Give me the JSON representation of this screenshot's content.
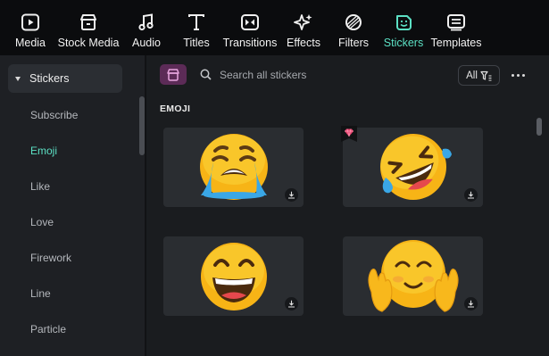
{
  "toolbar": {
    "items": [
      {
        "label": "Media",
        "icon": "media-icon"
      },
      {
        "label": "Stock Media",
        "icon": "stock-media-icon"
      },
      {
        "label": "Audio",
        "icon": "music-note-icon"
      },
      {
        "label": "Titles",
        "icon": "text-t-icon"
      },
      {
        "label": "Transitions",
        "icon": "transitions-icon"
      },
      {
        "label": "Effects",
        "icon": "effects-sparkle-icon"
      },
      {
        "label": "Filters",
        "icon": "filters-icon"
      },
      {
        "label": "Stickers",
        "icon": "stickers-icon",
        "active": true
      },
      {
        "label": "Templates",
        "icon": "templates-icon"
      }
    ]
  },
  "sidebar": {
    "header": "Stickers",
    "items": [
      {
        "label": "Subscribe"
      },
      {
        "label": "Emoji",
        "active": true
      },
      {
        "label": "Like"
      },
      {
        "label": "Love"
      },
      {
        "label": "Firework"
      },
      {
        "label": "Line"
      },
      {
        "label": "Particle"
      }
    ]
  },
  "search": {
    "placeholder": "Search all stickers"
  },
  "filter": {
    "label": "All"
  },
  "section": {
    "title": "EMOJI"
  },
  "stickers": [
    {
      "name": "loudly-crying-face",
      "premium": false,
      "icon": "download-icon"
    },
    {
      "name": "rolling-on-floor-laughing",
      "premium": true,
      "icon": "download-icon"
    },
    {
      "name": "grinning-face",
      "premium": false,
      "icon": "download-icon"
    },
    {
      "name": "hugging-face",
      "premium": false,
      "icon": "download-icon"
    }
  ],
  "colors": {
    "accent": "#5ce0c4",
    "background": "#1a1c1f",
    "sidebar": "#1e2024",
    "card": "#2a2d31",
    "premium_badge": "#e6436e",
    "emoji_yellow": "#f7b416"
  }
}
